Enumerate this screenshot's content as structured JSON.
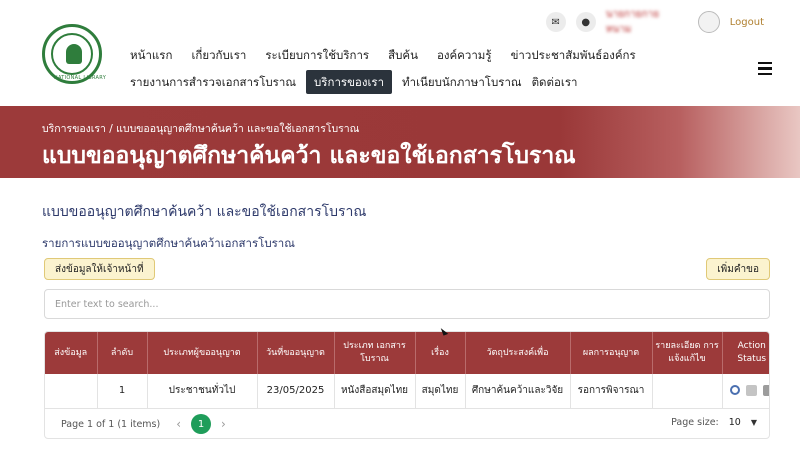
{
  "header": {
    "logo_text": "NATIONAL LIBRARY",
    "username": "นายกายกาย หนาม",
    "logout_label": "Logout",
    "icons": [
      "mail-icon",
      "chat-icon",
      "avatar-icon",
      "menu-icon"
    ]
  },
  "nav": {
    "row1": [
      "หน้าแรก",
      "เกี่ยวกับเรา",
      "ระเบียบการใช้บริการ",
      "สืบค้น",
      "องค์ความรู้",
      "ข่าวประชาสัมพันธ์องค์กร"
    ],
    "row2": [
      "รายงานการสำรวจเอกสารโบราณ",
      "บริการของเรา",
      "ทำเนียบนักภาษาโบราณ",
      "ติดต่อเรา"
    ],
    "active": "บริการของเรา"
  },
  "banner": {
    "breadcrumb": "บริการของเรา / แบบขออนุญาตศึกษาค้นคว้า และขอใช้เอกสารโบราณ",
    "title": "แบบขออนุญาตศึกษาค้นคว้า และขอใช้เอกสารโบราณ"
  },
  "main": {
    "heading": "แบบขออนุญาตศึกษาค้นคว้า และขอใช้เอกสารโบราณ",
    "subheading": "รายการแบบขออนุญาตศึกษาค้นคว้าเอกสารโบราณ",
    "send_button": "ส่งข้อมูลให้เจ้าหน้าที่",
    "add_button": "เพิ่มคำขอ",
    "search_placeholder": "Enter text to search..."
  },
  "table": {
    "columns": [
      "ส่งข้อมูล",
      "ลำดับ",
      "ประเภทผู้ขออนุญาต",
      "วันที่ขออนุญาต",
      "ประเภท เอกสารโบราณ",
      "เรื่อง",
      "วัตถุประสงค์เพื่อ",
      "ผลการอนุญาต",
      "รายละเอียด การแจ้งแก้ไข",
      "Action Status"
    ],
    "rows": [
      [
        "",
        "1",
        "ประชาชนทั่วไป",
        "23/05/2025",
        "หนังสือสมุดไทย",
        "สมุดไทย",
        "ศึกษาค้นคว้าและวิจัย",
        "รอการพิจารณา",
        ""
      ]
    ]
  },
  "pager": {
    "info": "Page 1 of 1 (1 items)",
    "current_page": "1",
    "prev": "‹",
    "next": "›",
    "page_size_label": "Page size:",
    "page_size_value": "10"
  },
  "colors": {
    "brand": "#9c3a3a",
    "nav_active": "#2b333c",
    "pager_active": "#1f9d5a",
    "heading": "#2e3a6b"
  }
}
